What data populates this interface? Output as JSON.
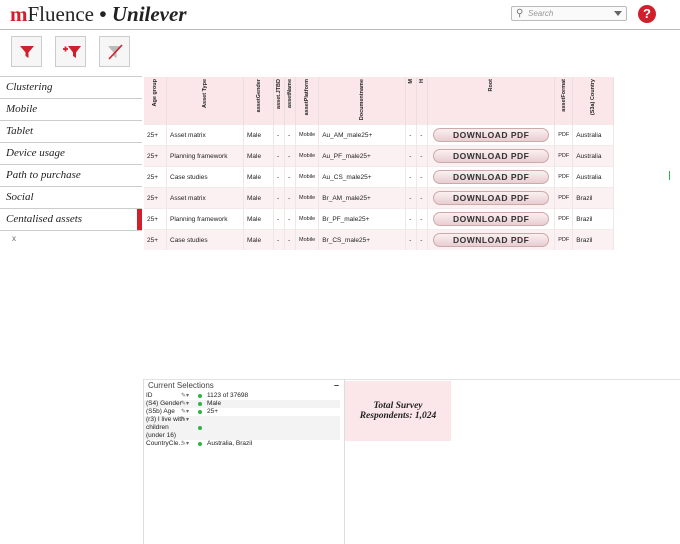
{
  "header": {
    "brand_m": "m",
    "brand_rest": "Fluence",
    "brand_sep": "•",
    "brand_client": "Unilever",
    "search_placeholder": "Search",
    "help_label": "?"
  },
  "toolbar": {
    "icons": [
      "filter-icon",
      "add-filter-icon",
      "clear-filter-icon"
    ]
  },
  "sidebar": {
    "items": [
      {
        "label": "Clustering"
      },
      {
        "label": "Mobile"
      },
      {
        "label": "Tablet"
      },
      {
        "label": "Device usage"
      },
      {
        "label": "Path to purchase"
      },
      {
        "label": "Social"
      },
      {
        "label": "Centalised assets"
      }
    ],
    "active_index": 6,
    "close_label": "x"
  },
  "table": {
    "headers": [
      "Age group",
      "Asset Type",
      "assetGender",
      "asset.JTBD",
      "assetName",
      "assetPlatform",
      "Documentname",
      "M",
      "H",
      "Root",
      "assetFormat",
      "(S3a) Country"
    ],
    "download_label": "DOWNLOAD PDF",
    "rows": [
      {
        "age": "25+",
        "type": "Asset matrix",
        "gender": "Male",
        "jtbd": "-",
        "name": "-",
        "platform": "Mobile",
        "doc": "Au_AM_male25+",
        "m": "-",
        "h": "-",
        "format": "PDF",
        "country": "Australia"
      },
      {
        "age": "25+",
        "type": "Planning framework",
        "gender": "Male",
        "jtbd": "-",
        "name": "-",
        "platform": "Mobile",
        "doc": "Au_PF_male25+",
        "m": "-",
        "h": "-",
        "format": "PDF",
        "country": "Australia"
      },
      {
        "age": "25+",
        "type": "Case studies",
        "gender": "Male",
        "jtbd": "-",
        "name": "-",
        "platform": "Mobile",
        "doc": "Au_CS_male25+",
        "m": "-",
        "h": "-",
        "format": "PDF",
        "country": "Australia"
      },
      {
        "age": "25+",
        "type": "Asset matrix",
        "gender": "Male",
        "jtbd": "-",
        "name": "-",
        "platform": "Mobile",
        "doc": "Br_AM_male25+",
        "m": "-",
        "h": "-",
        "format": "PDF",
        "country": "Brazil"
      },
      {
        "age": "25+",
        "type": "Planning framework",
        "gender": "Male",
        "jtbd": "-",
        "name": "-",
        "platform": "Mobile",
        "doc": "Br_PF_male25+",
        "m": "-",
        "h": "-",
        "format": "PDF",
        "country": "Brazil"
      },
      {
        "age": "25+",
        "type": "Case studies",
        "gender": "Male",
        "jtbd": "-",
        "name": "-",
        "platform": "Mobile",
        "doc": "Br_CS_male25+",
        "m": "-",
        "h": "-",
        "format": "PDF",
        "country": "Brazil"
      }
    ]
  },
  "current_selections": {
    "title": "Current Selections",
    "minimize": "–",
    "rows": [
      {
        "field": "ID",
        "value": "1123 of 37698",
        "has_dot": false
      },
      {
        "field": "(S4) Gender",
        "value": "Male",
        "has_dot": true
      },
      {
        "field": "(S5b) Age",
        "value": "25+",
        "has_dot": true
      },
      {
        "field": "(r3) I live with",
        "value": "",
        "has_dot": false
      },
      {
        "field": "children",
        "value": "",
        "has_dot": true
      },
      {
        "field": "(under 16)",
        "value": "",
        "has_dot": false
      },
      {
        "field": "CountryCle...",
        "value": "Australia, Brazil",
        "has_dot": true
      }
    ]
  },
  "survey_box": {
    "line1": "Total Survey",
    "line2": "Respondents: 1,024"
  }
}
